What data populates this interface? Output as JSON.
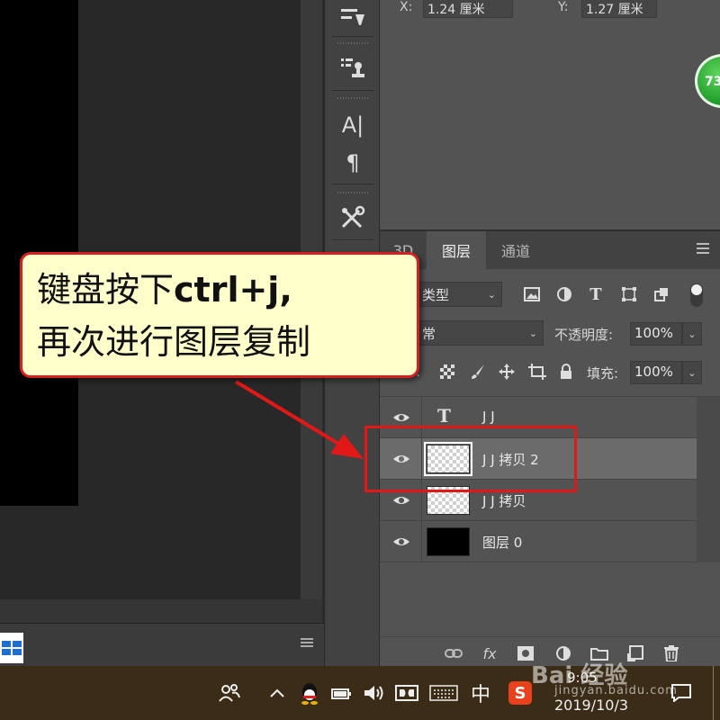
{
  "properties": {
    "x_label": "X:",
    "x_value": "1.24 厘米",
    "y_label": "Y:",
    "y_value": "1.27 厘米"
  },
  "badge": {
    "text": "73"
  },
  "tools": {
    "type_tool_glyph": "A|",
    "paragraph_glyph": "¶"
  },
  "layers_panel": {
    "tabs": [
      {
        "label": "3D"
      },
      {
        "label": "图层"
      },
      {
        "label": "通道"
      }
    ],
    "filter_kind": "类型",
    "blend_mode": "常",
    "opacity_label": "不透明度:",
    "opacity_value": "100%",
    "lock_label": ":",
    "fill_label": "填充:",
    "fill_value": "100%",
    "layers": [
      {
        "name": "J J",
        "kind": "text",
        "selected": false
      },
      {
        "name": "J J 拷贝 2",
        "kind": "pixel",
        "selected": true
      },
      {
        "name": "J J 拷贝",
        "kind": "pixel",
        "selected": false
      },
      {
        "name": "图层 0",
        "kind": "black",
        "selected": false
      }
    ],
    "footer_icons": [
      "link-icon",
      "fx-icon",
      "mask-icon",
      "adjustment-icon",
      "folder-icon",
      "new-layer-icon",
      "trash-icon"
    ],
    "fx_text": "fx"
  },
  "callout": {
    "line1_prefix": "键盘按下",
    "line1_bold": "ctrl+j",
    "line1_suffix": ",",
    "line2": "再次进行图层复制"
  },
  "taskbar": {
    "input_method": "中",
    "sogou_label": "S",
    "time": "9:05",
    "date": "2019/10/3",
    "watermark": "Bai 经验",
    "watermark_url": "jingyan.baidu.com"
  },
  "colors": {
    "callout_border": "#d42020",
    "callout_bg": "#ffffcc",
    "highlight": "#e01818",
    "badge_green": "#1f9a28"
  }
}
